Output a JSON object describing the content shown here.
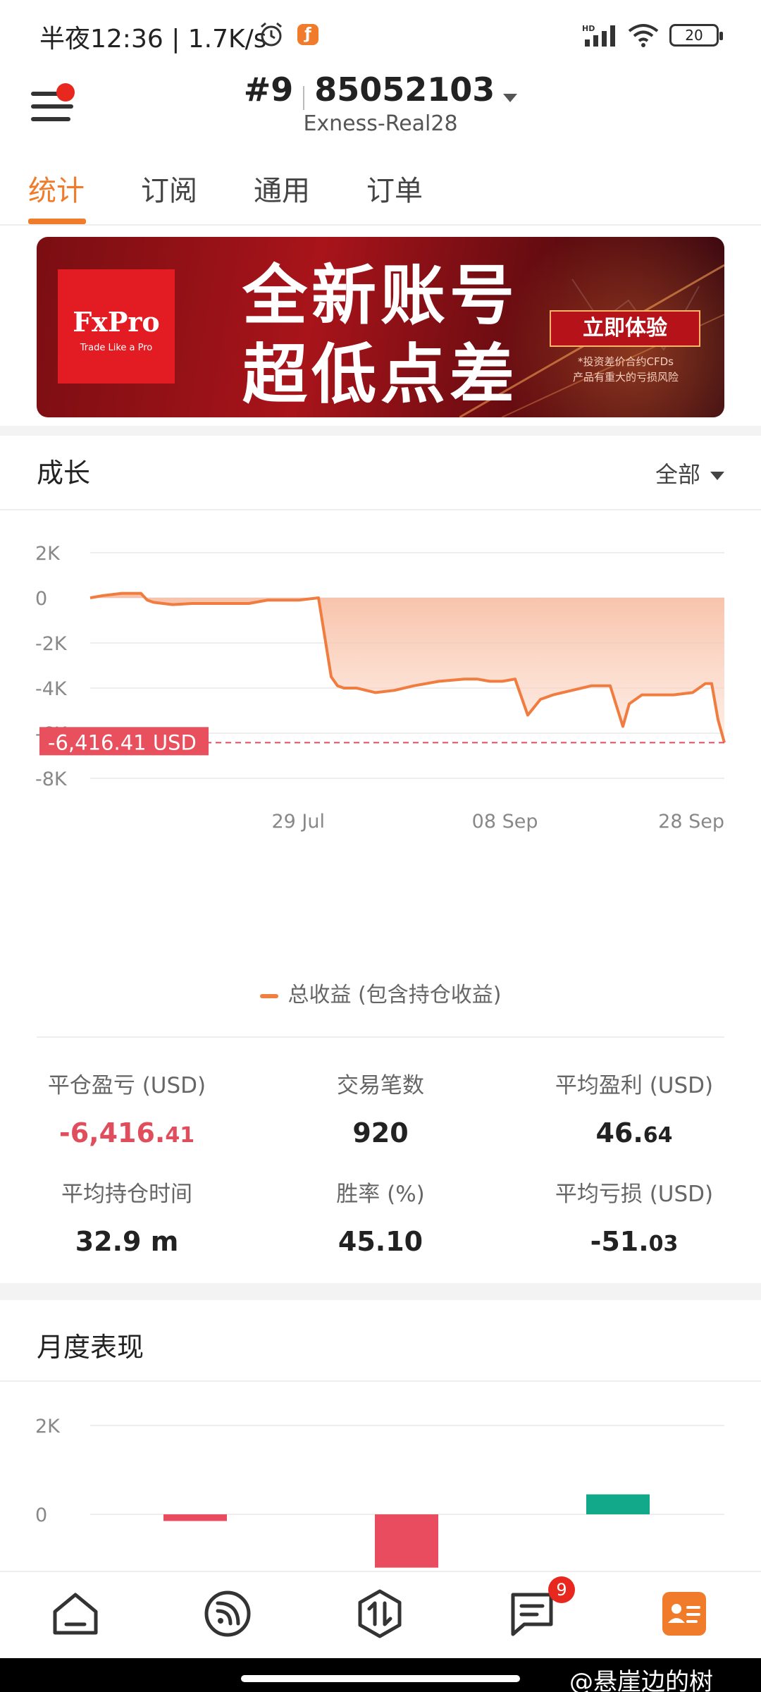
{
  "status_bar": {
    "time_speed": "半夜12:36 | 1.7K/s",
    "network": "HD",
    "battery": "20"
  },
  "header": {
    "account_index": "#9",
    "account_number": "85052103",
    "server": "Exness-Real28"
  },
  "tabs": [
    {
      "label": "统计",
      "active": true
    },
    {
      "label": "订阅",
      "active": false
    },
    {
      "label": "通用",
      "active": false
    },
    {
      "label": "订单",
      "active": false
    }
  ],
  "banner": {
    "brand": "FxPro",
    "brand_tagline": "Trade Like a Pro",
    "headline_line1": "全新账号",
    "headline_line2": "超低点差",
    "cta": "立即体验",
    "note_line1": "*投资差价合约CFDs",
    "note_line2": "产品有重大的亏损风险"
  },
  "growth": {
    "title": "成长",
    "filter_label": "全部",
    "current_value_label": "-6,416.41 USD",
    "legend": "总收益 (包含持仓收益)"
  },
  "chart_data": [
    {
      "type": "area",
      "title": "成长",
      "yticks": [
        "2K",
        "0",
        "-2K",
        "-4K",
        "-6K",
        "-8K"
      ],
      "ylim": [
        -8000,
        2000
      ],
      "xticks": [
        {
          "label": "29 Jul",
          "at": 0.328
        },
        {
          "label": "08 Sep",
          "at": 0.654
        },
        {
          "label": "28 Sep",
          "at": 1.0
        }
      ],
      "x": [
        0,
        0.02,
        0.05,
        0.08,
        0.09,
        0.1,
        0.13,
        0.16,
        0.2,
        0.25,
        0.28,
        0.3,
        0.33,
        0.36,
        0.38,
        0.39,
        0.4,
        0.42,
        0.45,
        0.48,
        0.51,
        0.55,
        0.59,
        0.61,
        0.63,
        0.65,
        0.67,
        0.69,
        0.71,
        0.73,
        0.76,
        0.79,
        0.82,
        0.84,
        0.85,
        0.87,
        0.89,
        0.92,
        0.95,
        0.97,
        0.98,
        0.99,
        1.0
      ],
      "values": [
        0,
        100,
        200,
        200,
        -100,
        -200,
        -300,
        -250,
        -250,
        -250,
        -100,
        -100,
        -100,
        0,
        -3500,
        -3900,
        -4000,
        -4000,
        -4200,
        -4100,
        -3900,
        -3700,
        -3600,
        -3600,
        -3700,
        -3700,
        -3600,
        -5200,
        -4500,
        -4300,
        -4100,
        -3900,
        -3900,
        -5700,
        -4700,
        -4300,
        -4300,
        -4300,
        -4200,
        -3800,
        -3800,
        -5400,
        -6416.41
      ],
      "reference_line": -6416.41,
      "series_color": "#f07c40"
    },
    {
      "type": "bar",
      "title": "月度表现",
      "yticks": [
        "2K",
        "0"
      ],
      "ylim": [
        -1200,
        2000
      ],
      "categories": [
        "",
        "",
        ""
      ],
      "values": [
        -150,
        -1200,
        450
      ],
      "colors": [
        "#e84c5e",
        "#e84c5e",
        "#12a88a"
      ]
    }
  ],
  "stats": [
    {
      "label": "平仓盈亏 (USD)",
      "value_main": "-6,416.",
      "value_decimal": "41",
      "negative": true
    },
    {
      "label": "交易笔数",
      "value_main": "920",
      "value_decimal": "",
      "negative": false
    },
    {
      "label": "平均盈利 (USD)",
      "value_main": "46.",
      "value_decimal": "64",
      "negative": false
    },
    {
      "label": "平均持仓时间",
      "value_main": "32.9 m",
      "value_decimal": "",
      "negative": false
    },
    {
      "label": "胜率 (%)",
      "value_main": "45.10",
      "value_decimal": "",
      "negative": false
    },
    {
      "label": "平均亏损 (USD)",
      "value_main": "-51.",
      "value_decimal": "03",
      "negative": false
    }
  ],
  "monthly": {
    "title": "月度表现"
  },
  "bottom_nav": {
    "items": [
      "home-icon",
      "feed-icon",
      "trade-icon",
      "messages-icon",
      "profile-icon"
    ],
    "messages_badge": "9"
  },
  "watermark": "@悬崖边的树"
}
